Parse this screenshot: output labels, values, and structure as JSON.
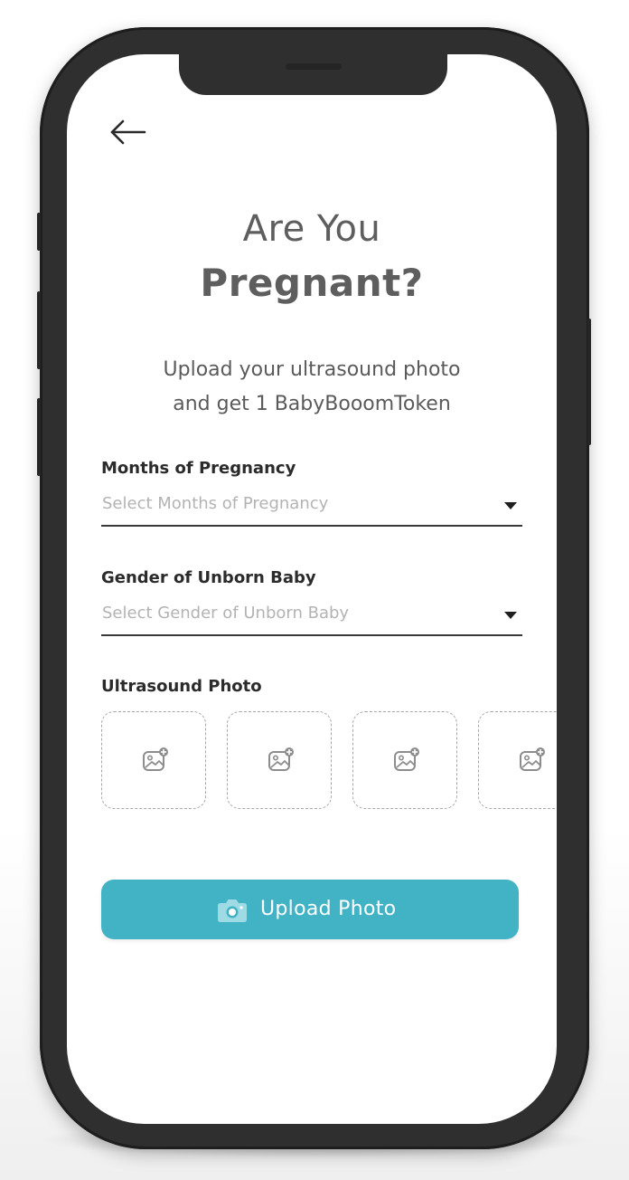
{
  "header": {
    "back_icon": "arrow-left-icon"
  },
  "title": {
    "line1": "Are You",
    "line2": "Pregnant?"
  },
  "subtitle": {
    "line1": "Upload your ultrasound photo",
    "line2": "and get 1 BabyBooomToken"
  },
  "form": {
    "months": {
      "label": "Months of Pregnancy",
      "placeholder": "Select Months of Pregnancy"
    },
    "gender": {
      "label": "Gender of Unborn Baby",
      "placeholder": "Select Gender of Unborn Baby"
    },
    "photos": {
      "label": "Ultrasound Photo",
      "slot_icon": "add-image-icon"
    }
  },
  "upload_button": {
    "label": "Upload Photo",
    "icon": "camera-icon",
    "color": "#41b3c4"
  }
}
